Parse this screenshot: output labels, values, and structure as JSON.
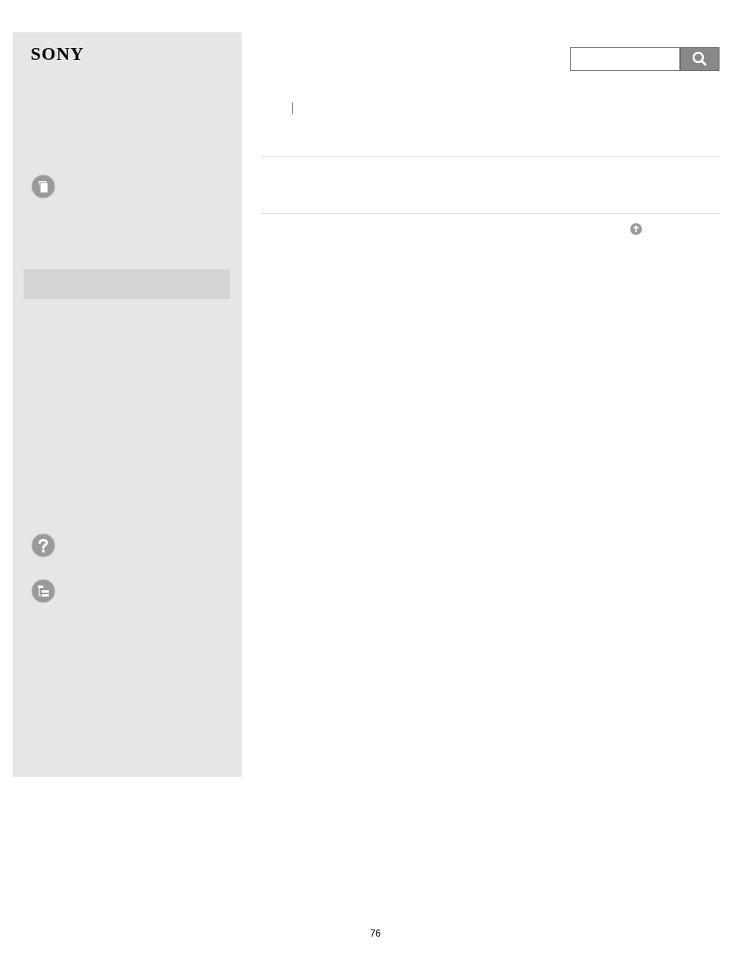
{
  "logo": "SONY",
  "page_number": "76"
}
